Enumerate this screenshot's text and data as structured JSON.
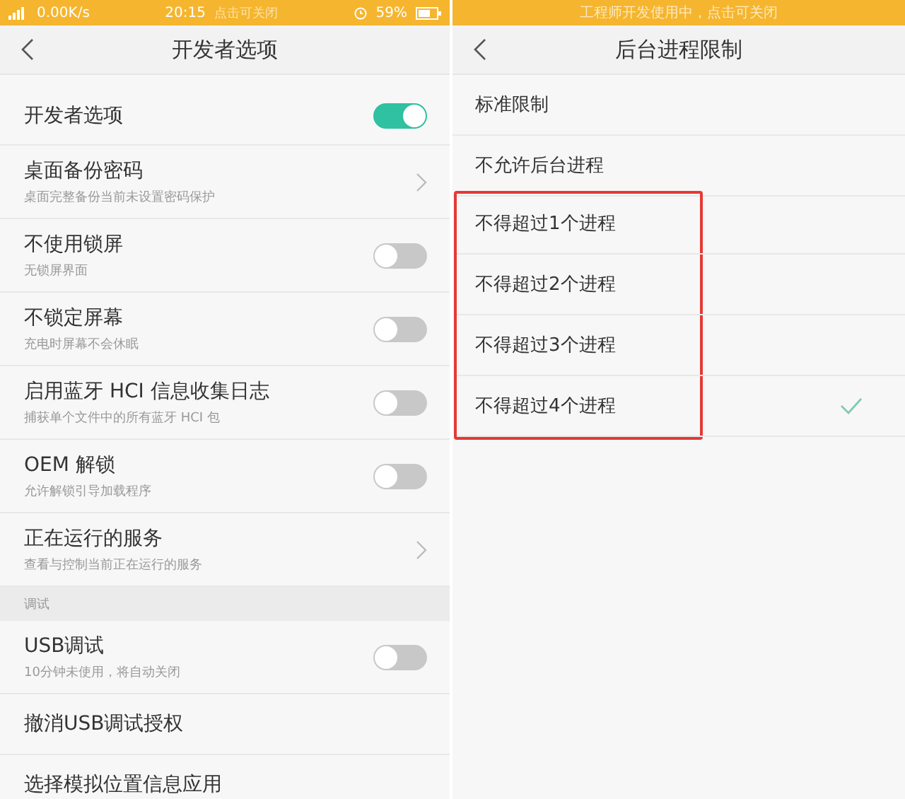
{
  "left_screen": {
    "status_bar": {
      "speed": "0.00K/s",
      "time": "20:15",
      "banner": "点击可关闭",
      "battery": "59%"
    },
    "title": "开发者选项",
    "items": [
      {
        "kind": "toggle",
        "title": "开发者选项",
        "on": true
      },
      {
        "kind": "link",
        "title": "桌面备份密码",
        "subtitle": "桌面完整备份当前未设置密码保护"
      },
      {
        "kind": "toggle",
        "title": "不使用锁屏",
        "subtitle": "无锁屏界面",
        "on": false
      },
      {
        "kind": "toggle",
        "title": "不锁定屏幕",
        "subtitle": "充电时屏幕不会休眠",
        "on": false
      },
      {
        "kind": "toggle",
        "title": "启用蓝牙 HCI 信息收集日志",
        "subtitle": "捕获单个文件中的所有蓝牙 HCI 包",
        "on": false
      },
      {
        "kind": "toggle",
        "title": "OEM 解锁",
        "subtitle": "允许解锁引导加载程序",
        "on": false
      },
      {
        "kind": "link",
        "title": "正在运行的服务",
        "subtitle": "查看与控制当前正在运行的服务"
      },
      {
        "kind": "section",
        "title": "调试"
      },
      {
        "kind": "toggle",
        "title": "USB调试",
        "subtitle": "10分钟未使用，将自动关闭",
        "on": false
      },
      {
        "kind": "plain",
        "title": "撤消USB调试授权"
      },
      {
        "kind": "plain",
        "title": "选择模拟位置信息应用"
      }
    ]
  },
  "right_screen": {
    "banner": "工程师开发使用中，点击可关闭",
    "title": "后台进程限制",
    "options": [
      {
        "label": "标准限制",
        "selected": false,
        "highlighted": false
      },
      {
        "label": "不允许后台进程",
        "selected": false,
        "highlighted": false
      },
      {
        "label": "不得超过1个进程",
        "selected": false,
        "highlighted": true
      },
      {
        "label": "不得超过2个进程",
        "selected": false,
        "highlighted": true
      },
      {
        "label": "不得超过3个进程",
        "selected": false,
        "highlighted": true
      },
      {
        "label": "不得超过4个进程",
        "selected": true,
        "highlighted": true
      }
    ]
  }
}
